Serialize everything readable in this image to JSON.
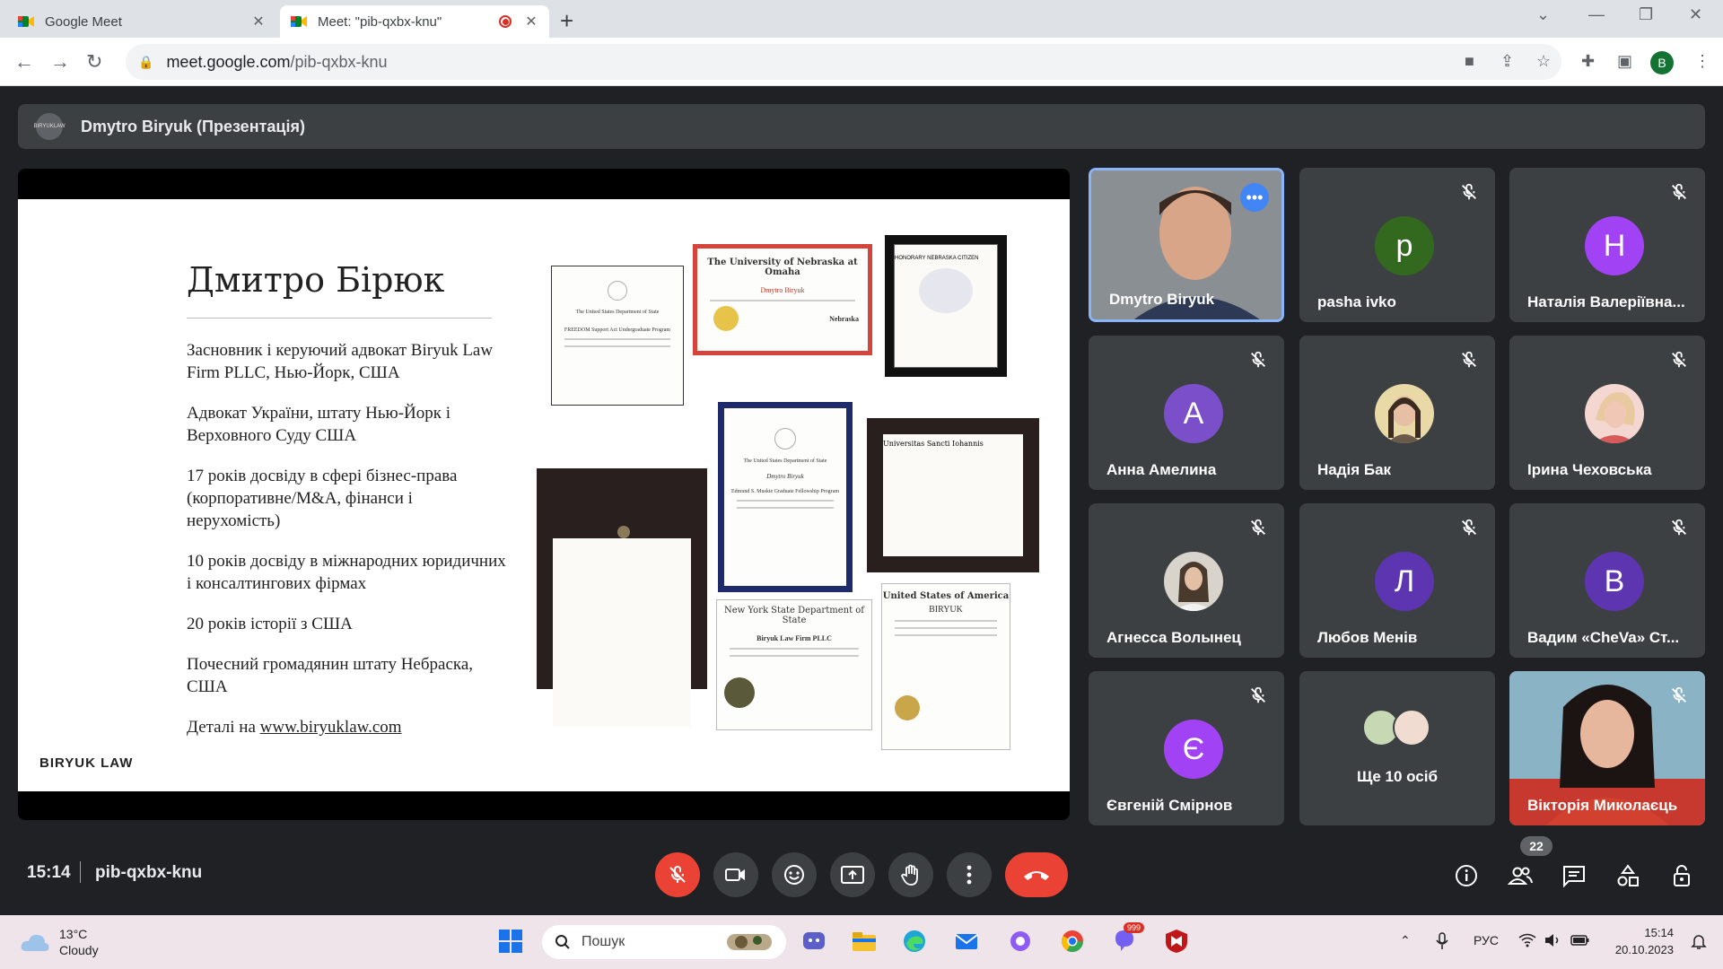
{
  "browser": {
    "tabs": [
      {
        "title": "Google Meet"
      },
      {
        "title": "Meet: \"pib-qxbx-knu\""
      }
    ],
    "url_host": "meet.google.com",
    "url_path": "/pib-qxbx-knu",
    "profile_initial": "B"
  },
  "meet": {
    "presenter_logo": "BIRYUKLAW",
    "presentation_title": "Dmytro Biryuk (Презентація)",
    "time": "15:14",
    "code": "pib-qxbx-knu",
    "participants_count": "22"
  },
  "slide": {
    "title": "Дмитро Бірюк",
    "bullets": [
      "Засновник і керуючий адвокат Biryuk Law Firm PLLC, Нью-Йорк, США",
      "Адвокат України, штату Нью-Йорк і Верховного Суду США",
      "17 років досвіду в сфері бізнес-права (корпоративне/M&A, фінанси і нерухомість)",
      "10 років досвіду в міжнародних юридичних і консалтингових фірмах",
      "20 років історії з США",
      "Почесний громадянин штату Небраска, США"
    ],
    "details_prefix": "Деталі на ",
    "details_link": "www.biryuklaw.com",
    "brand": "BIRYUK LAW",
    "cert_omaha": "The University of Nebraska at Omaha",
    "cert_omaha_name": "Dmytro Biryuk",
    "cert_omaha_logo": "Nebraska",
    "cert_ny": "New York State Department of State",
    "cert_ny_firm": "Biryuk Law Firm PLLC",
    "cert_us": "United States of America",
    "cert_us_name": "BIRYUK",
    "cert_honorary": "HONORARY NEBRASKA CITIZEN",
    "cert_state_dept": "The United States Department of State",
    "cert_freedom": "FREEDOM Support Act Undergraduate Program",
    "cert_muskie_name": "Dmytro Biryuk",
    "cert_muskie": "Edmund S. Muskie Graduate Fellowship Program",
    "cert_sjsu": "Universitas Sancti Iohannis"
  },
  "participants": [
    {
      "name": "Dmytro Biryuk",
      "type": "video"
    },
    {
      "name": "pasha ivko",
      "initial": "p",
      "color": "#33691e"
    },
    {
      "name": "Наталія Валеріївна...",
      "initial": "Н",
      "color": "#a142f4"
    },
    {
      "name": "Анна Амелина",
      "initial": "А",
      "color": "#7b4fc9"
    },
    {
      "name": "Надія Бак",
      "type": "photo"
    },
    {
      "name": "Ірина Чеховська",
      "type": "photo"
    },
    {
      "name": "Агнесса Волынец",
      "type": "photo"
    },
    {
      "name": "Любов Менів",
      "initial": "Л",
      "color": "#5e35b1"
    },
    {
      "name": "Вадим «CheVa» Ст...",
      "initial": "В",
      "color": "#5e35b1"
    },
    {
      "name": "Євгеній Смірнов",
      "initial": "Є",
      "color": "#a142f4"
    },
    {
      "name": "Ще 10 осіб",
      "type": "others"
    },
    {
      "name": "Вікторія Миколаєць",
      "type": "video"
    }
  ],
  "taskbar": {
    "temperature": "13°C",
    "weather": "Cloudy",
    "search_placeholder": "Пошук",
    "notif_badge": "999",
    "language": "РУС",
    "clock_time": "15:14",
    "clock_date": "20.10.2023"
  },
  "colors": {
    "accent": "#8ab4f8",
    "danger": "#ea4335"
  }
}
